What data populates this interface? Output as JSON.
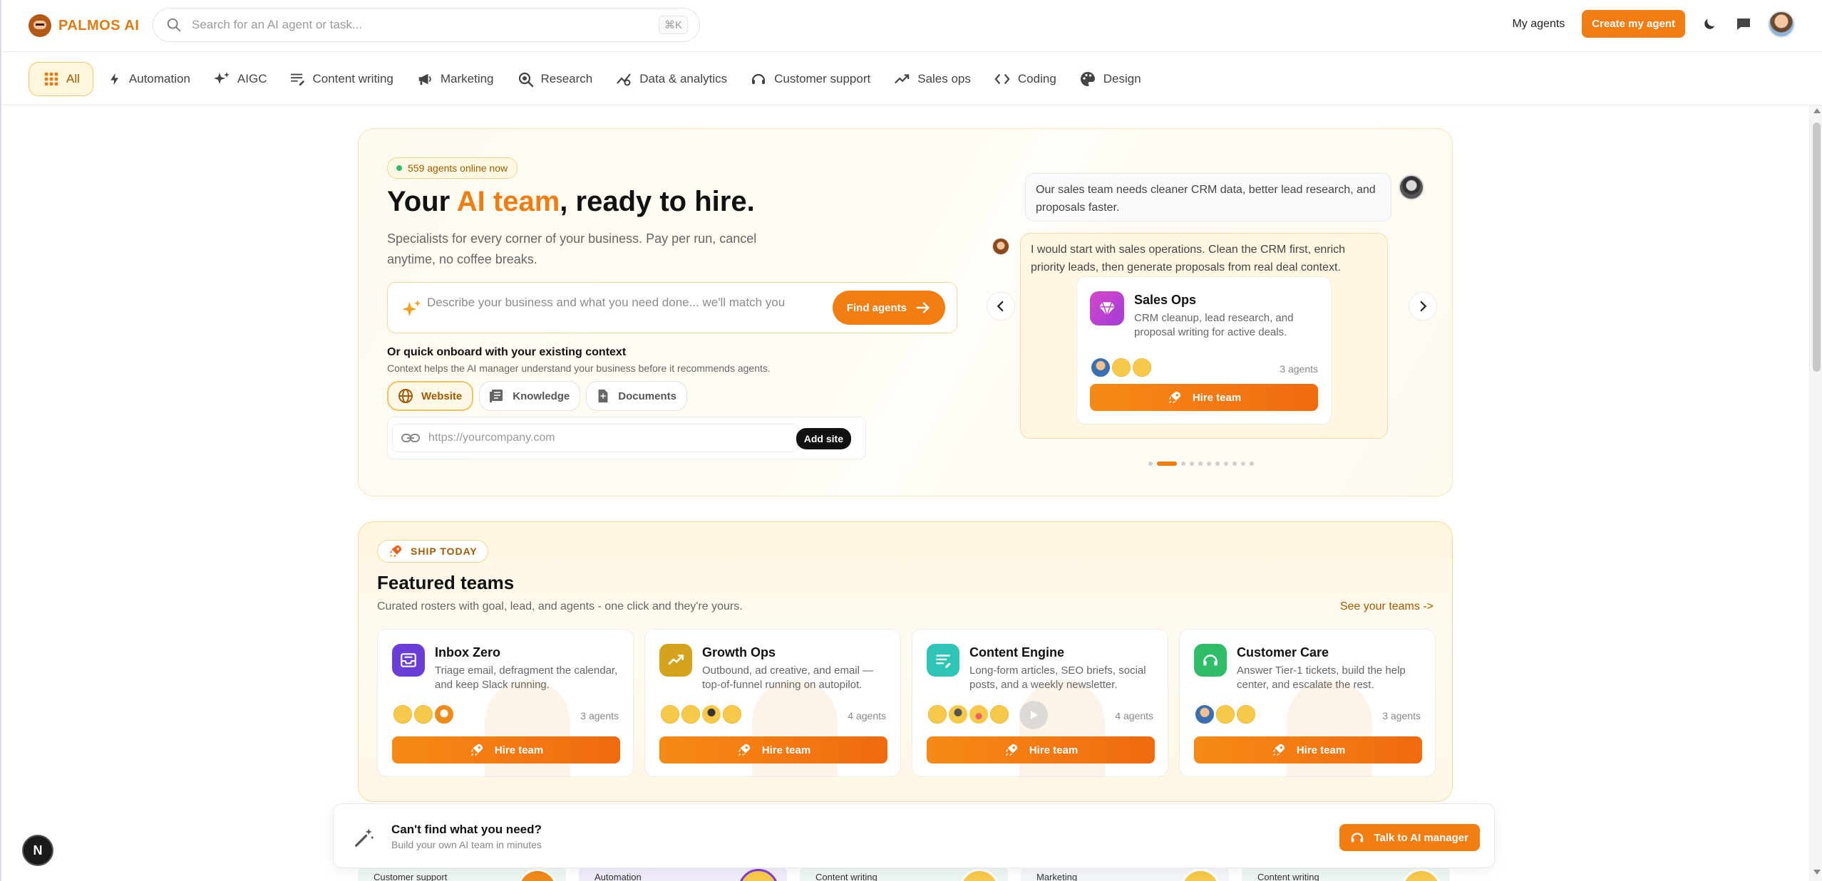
{
  "header": {
    "logo": "PALMOS AI",
    "search_placeholder": "Search for an AI agent or task...",
    "search_shortcut": "⌘K",
    "my_agents": "My agents",
    "create_agent": "Create my agent"
  },
  "categories": [
    {
      "label": "All",
      "icon": "grid-icon"
    },
    {
      "label": "Automation",
      "icon": "lightning-icon"
    },
    {
      "label": "AIGC",
      "icon": "sparkles-icon"
    },
    {
      "label": "Content writing",
      "icon": "text-lines-icon"
    },
    {
      "label": "Marketing",
      "icon": "megaphone-icon"
    },
    {
      "label": "Research",
      "icon": "research-icon"
    },
    {
      "label": "Data & analytics",
      "icon": "chart-icon"
    },
    {
      "label": "Customer support",
      "icon": "headset-icon"
    },
    {
      "label": "Sales ops",
      "icon": "trend-up-icon"
    },
    {
      "label": "Coding",
      "icon": "code-icon"
    },
    {
      "label": "Design",
      "icon": "palette-icon"
    }
  ],
  "hero": {
    "online": "559 agents online now",
    "title_pre": "Your ",
    "title_accent": "AI team",
    "title_post": ", ready to hire.",
    "subtitle": "Specialists for every corner of your business. Pay per run, cancel anytime, no coffee breaks.",
    "describe_placeholder": "Describe your business and what you need done... we'll match you",
    "find_agents": "Find agents",
    "quick_title": "Or quick onboard with your existing context",
    "quick_sub": "Context helps the AI manager understand your business before it recommends agents.",
    "context_tabs": [
      "Website",
      "Knowledge",
      "Documents"
    ],
    "site_placeholder": "https://yourcompany.com",
    "add_site": "Add site"
  },
  "chat": {
    "user_message": "Our sales team needs cleaner CRM data, better lead research, and proposals faster.",
    "bot_message": "I would start with sales operations. Clean the CRM first, enrich priority leads, then generate proposals from real deal context.",
    "team_name": "Sales Ops",
    "team_desc": "CRM cleanup, lead research, and proposal writing for active deals.",
    "team_count": "3 agents",
    "hire_team": "Hire team",
    "active_slide": 2,
    "slide_count": 11
  },
  "featured": {
    "tag": "SHIP TODAY",
    "title": "Featured teams",
    "subtitle": "Curated rosters with goal, lead, and agents - one click and they're yours.",
    "see_teams": "See your teams ->",
    "teams": [
      {
        "name": "Inbox Zero",
        "desc": "Triage email, defragment the calendar, and keep Slack running.",
        "count": "3 agents",
        "hire": "Hire team",
        "color": "#6a3fd6"
      },
      {
        "name": "Growth Ops",
        "desc": "Outbound, ad creative, and email — top-of-funnel running on autopilot.",
        "count": "4 agents",
        "hire": "Hire team",
        "color": "#d4a21c"
      },
      {
        "name": "Content Engine",
        "desc": "Long-form articles, SEO briefs, social posts, and a weekly newsletter.",
        "count": "4 agents",
        "hire": "Hire team",
        "color": "#2ec4b6"
      },
      {
        "name": "Customer Care",
        "desc": "Answer Tier-1 tickets, build the help center, and escalate the rest.",
        "count": "3 agents",
        "hire": "Hire team",
        "color": "#2fbd6a"
      }
    ]
  },
  "bottom_cards": [
    "Customer support",
    "Automation",
    "Content writing",
    "Marketing",
    "Content writing"
  ],
  "cant_find": {
    "title": "Can't find what you need?",
    "sub": "Build your own AI team in minutes",
    "button": "Talk to AI manager"
  },
  "dev_badge": "N"
}
